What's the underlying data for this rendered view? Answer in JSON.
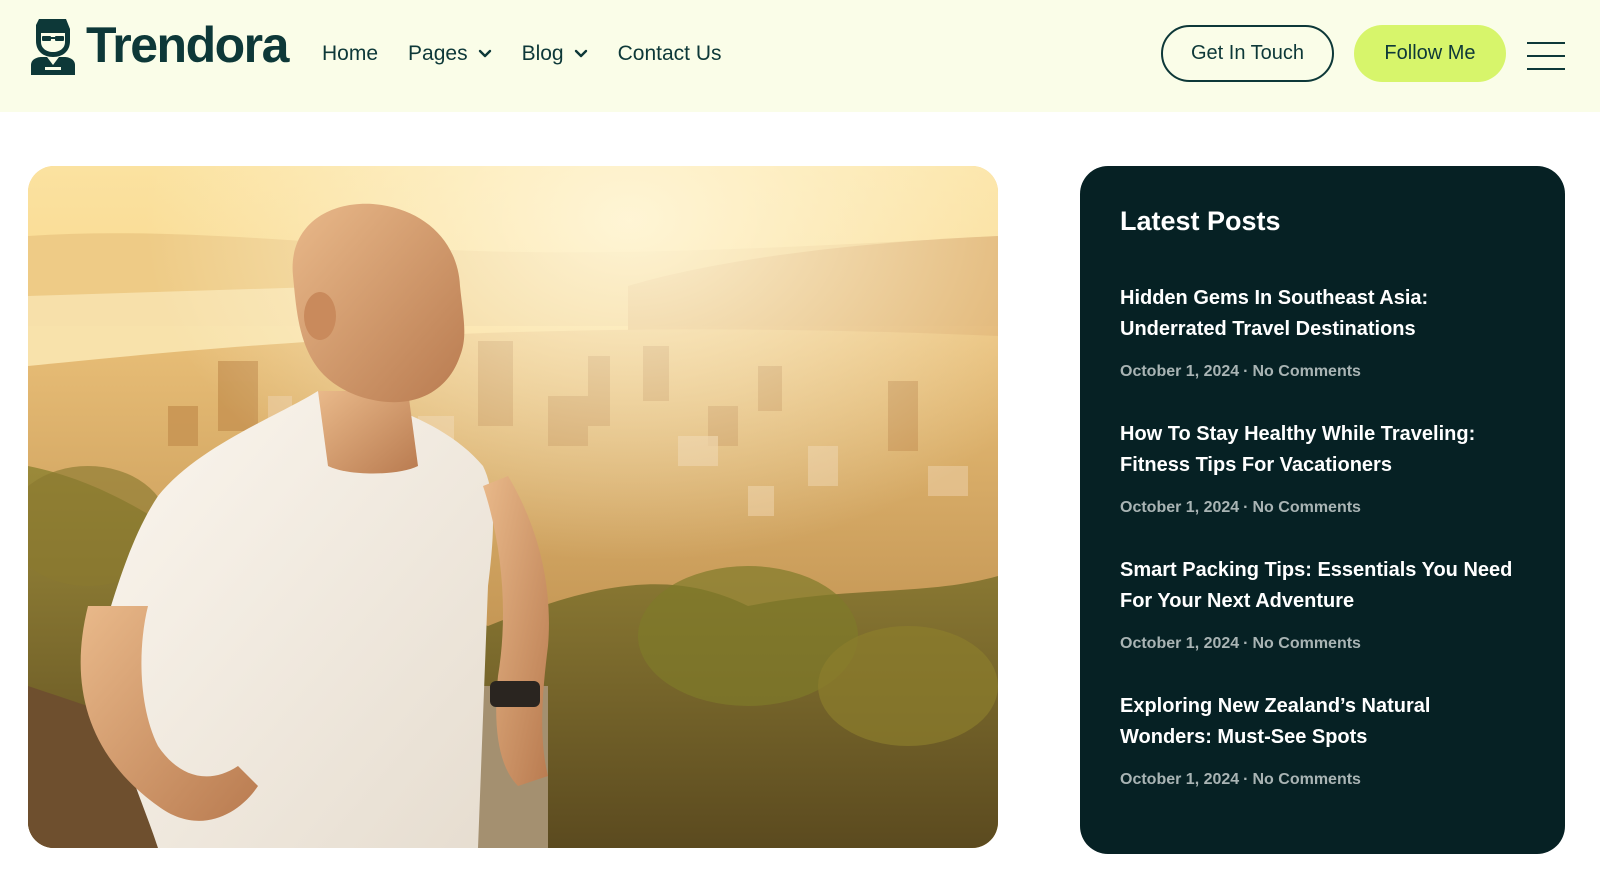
{
  "brand": {
    "name": "Trendora",
    "logo_icon": "person-avatar-icon"
  },
  "nav": {
    "items": [
      {
        "label": "Home",
        "has_dropdown": false
      },
      {
        "label": "Pages",
        "has_dropdown": true
      },
      {
        "label": "Blog",
        "has_dropdown": true
      },
      {
        "label": "Contact Us",
        "has_dropdown": false
      }
    ]
  },
  "header_actions": {
    "get_in_touch": "Get In Touch",
    "follow_me": "Follow Me",
    "menu_icon": "hamburger-menu-icon"
  },
  "hero": {
    "image_subject": "runner-city-sunset"
  },
  "sidebar": {
    "title": "Latest Posts",
    "posts": [
      {
        "title": "Hidden Gems In Southeast Asia: Underrated Travel Destinations",
        "date": "October 1, 2024",
        "comments": "No Comments"
      },
      {
        "title": "How To Stay Healthy While Traveling: Fitness Tips For Vacationers",
        "date": "October 1, 2024",
        "comments": "No Comments"
      },
      {
        "title": "Smart Packing Tips: Essentials You Need For Your Next Adventure",
        "date": "October 1, 2024",
        "comments": "No Comments"
      },
      {
        "title": "Exploring New Zealand’s Natural Wonders: Must-See Spots",
        "date": "October 1, 2024",
        "comments": "No Comments"
      }
    ]
  },
  "colors": {
    "header_bg": "#fafde8",
    "brand_dark": "#0d3838",
    "accent": "#d7f56b",
    "sidebar_bg": "#062124",
    "meta_text": "#a9b4b4"
  }
}
